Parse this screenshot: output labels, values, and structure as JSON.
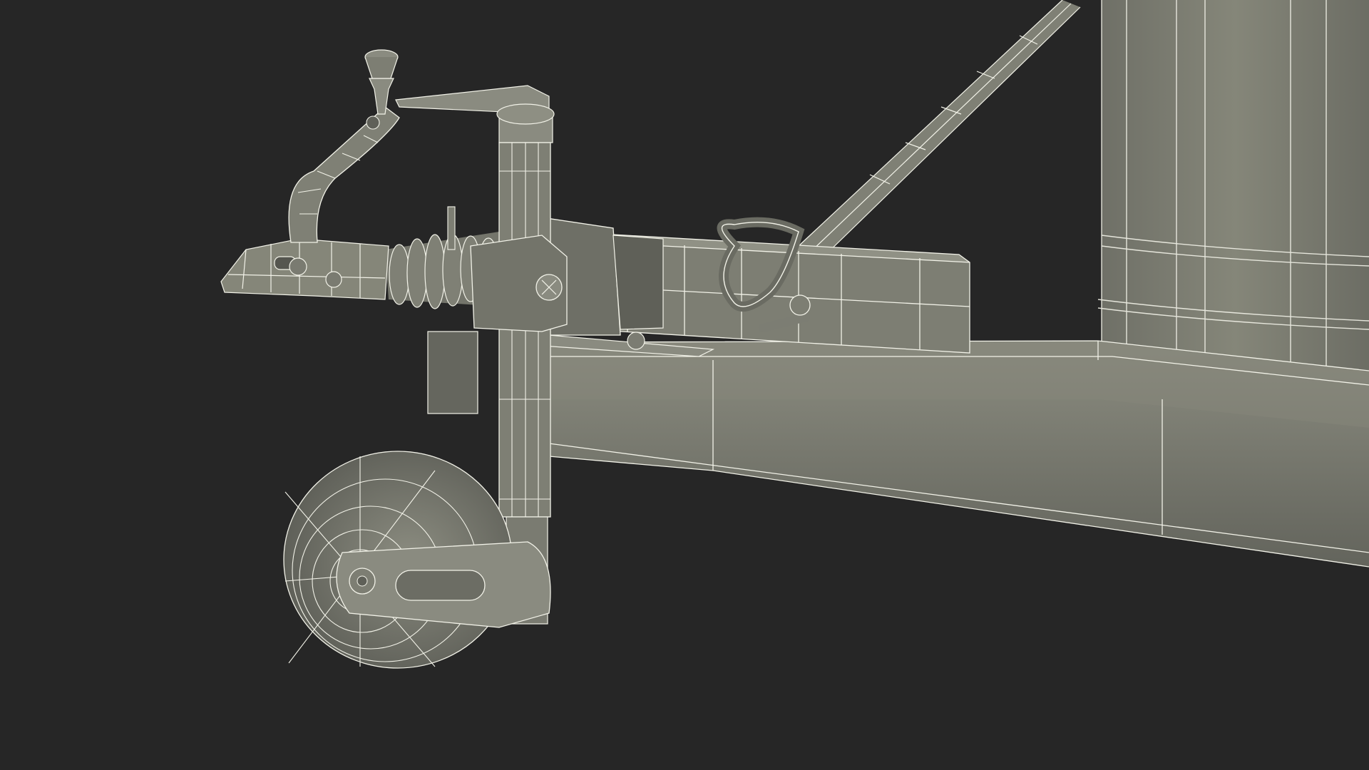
{
  "scene": {
    "background_color": "#262626",
    "surface_color": "#7d7e73",
    "surface_light": "#8f9085",
    "surface_dark": "#5f6058",
    "wire_color": "#f2f2e8",
    "parts": [
      "trailer-drawbar",
      "hitch-coupler-head",
      "coupler-handle",
      "bellows-boot",
      "jockey-wheel-post",
      "jockey-wheel",
      "safety-chain-ring",
      "side-rail",
      "trailer-body-tank",
      "support-strut"
    ]
  }
}
